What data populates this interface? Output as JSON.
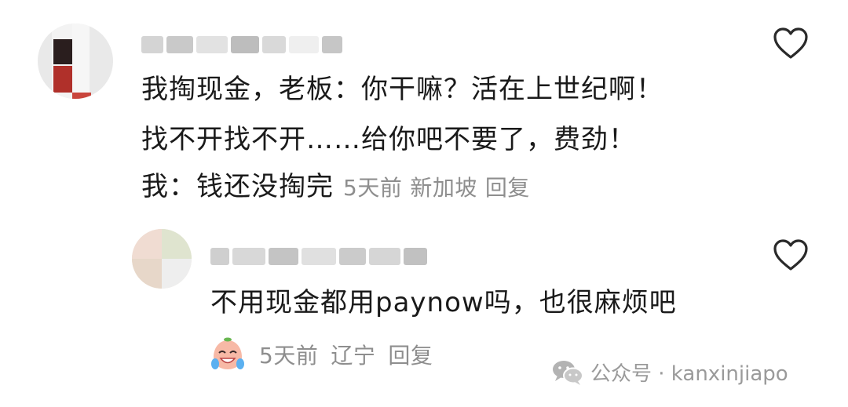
{
  "comments": [
    {
      "text_lines": [
        "我掏现金，老板：你干嘛？活在上世纪啊！",
        "找不开找不开……给你吧不要了，费劲！",
        "我：钱还没掏完"
      ],
      "time": "5天前",
      "location": "新加坡",
      "reply_label": "回复"
    },
    {
      "text": "不用现金都用paynow吗，也很麻烦吧",
      "time": "5天前",
      "location": "辽宁",
      "reply_label": "回复",
      "emoji": "crying-laughing-emoji"
    }
  ],
  "icons": {
    "like": "heart-outline-icon",
    "watermark": "wechat-icon"
  },
  "watermark": {
    "text": "公众号 · kanxinjiapo"
  },
  "colors": {
    "text": "#1a1a1a",
    "meta": "#8e8e8e",
    "heart_stroke": "#2a2a2a",
    "watermark": "#9a9a9a"
  }
}
